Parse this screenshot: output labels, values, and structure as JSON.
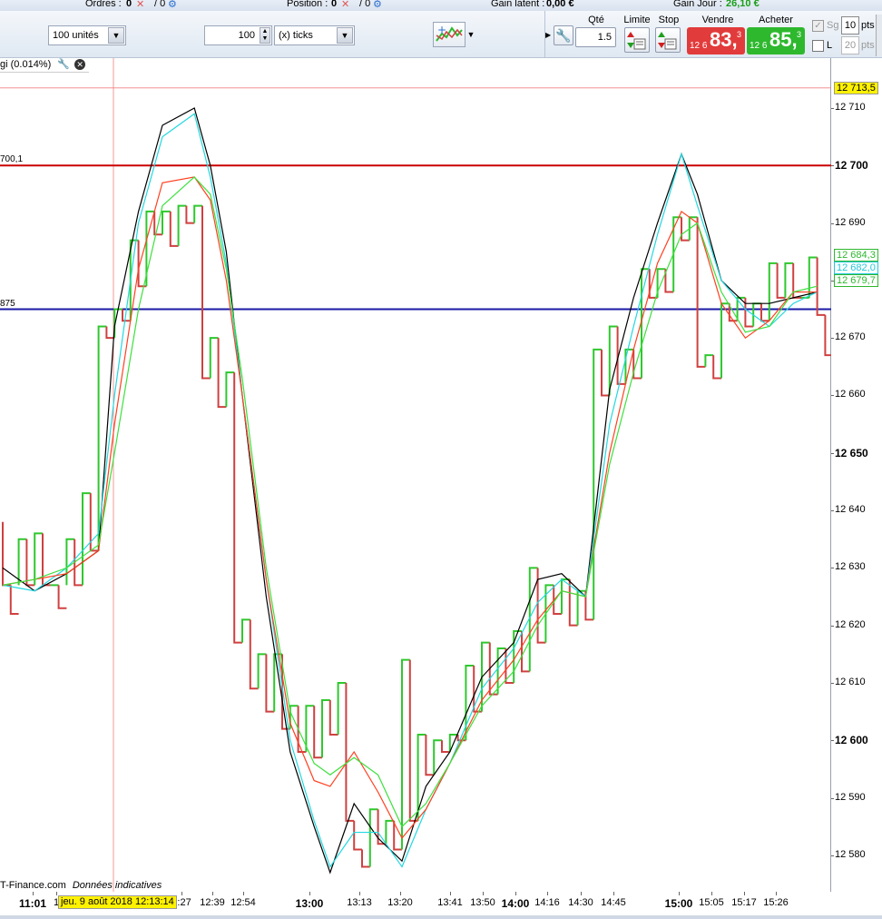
{
  "topbar": {
    "orders_label": "Ordres :",
    "orders_val1": "0",
    "orders_val2": "/ 0",
    "position_label": "Position :",
    "position_val1": "0",
    "position_val2": "/ 0",
    "latent_label": "Gain latent :",
    "latent_value": "0,00 €",
    "day_label": "Gain Jour :",
    "day_value": "26,10 €",
    "day_color": "#1a9e1a"
  },
  "toolbar": {
    "units_value": "100 unités",
    "ticks_value": "100",
    "ticks_unit": "(x) ticks"
  },
  "trade": {
    "qty_label": "Qté",
    "qty_value": "1.5",
    "limit_label": "Limite",
    "stop_label": "Stop",
    "sell_label": "Vendre",
    "buy_label": "Acheter",
    "sell_prefix": "12 6",
    "sell_big": "83,",
    "sell_sup": "3",
    "buy_prefix": "12 6",
    "buy_big": "85,",
    "buy_sup": "3",
    "sg_label": "Sg",
    "l_label": "L",
    "pts1_value": "10",
    "pts2_value": "20",
    "pts_label": "pts",
    "sell_color": "#e23b3b",
    "buy_color": "#2eb82e"
  },
  "chart": {
    "indicator_label": "gi (0.014%)",
    "level1_label": "700,1",
    "level2_label": "875",
    "source_label": "T-Finance.com",
    "source_note": "Données indicatives",
    "date_badge": "jeu. 9 août 2018 12:13:14",
    "level1_value": 12700,
    "level2_value": 12675,
    "cursor_value": 12713.5,
    "red_line_color": "#cc0000",
    "blue_line_color": "#1a1aa6"
  },
  "yaxis": {
    "cursor_badge": "12 713,5",
    "ticks": [
      {
        "label": "12 710",
        "v": 12710,
        "major": false
      },
      {
        "label": "12 700",
        "v": 12700,
        "major": true
      },
      {
        "label": "12 690",
        "v": 12690,
        "major": false
      },
      {
        "label": "12 680",
        "v": 12680,
        "major": false
      },
      {
        "label": "12 670",
        "v": 12670,
        "major": false
      },
      {
        "label": "12 660",
        "v": 12660,
        "major": false
      },
      {
        "label": "12 650",
        "v": 12650,
        "major": true
      },
      {
        "label": "12 640",
        "v": 12640,
        "major": false
      },
      {
        "label": "12 630",
        "v": 12630,
        "major": false
      },
      {
        "label": "12 620",
        "v": 12620,
        "major": false
      },
      {
        "label": "12 610",
        "v": 12610,
        "major": false
      },
      {
        "label": "12 600",
        "v": 12600,
        "major": true
      },
      {
        "label": "12 590",
        "v": 12590,
        "major": false
      },
      {
        "label": "12 580",
        "v": 12580,
        "major": false
      }
    ],
    "badges": [
      {
        "label": "12 684,3",
        "v": 12684.3,
        "color": "#2eb82e"
      },
      {
        "label": "12 682,0",
        "v": 12682.0,
        "color": "#22c8d8"
      },
      {
        "label": "12 679,7",
        "v": 12679.7,
        "color": "#2eb82e"
      }
    ]
  },
  "xaxis": {
    "ticks": [
      {
        "label": "11:01",
        "major": true
      },
      {
        "label": "1",
        "major": false
      },
      {
        "label": "2:27",
        "major": false
      },
      {
        "label": "12:39",
        "major": false
      },
      {
        "label": "12:54",
        "major": false
      },
      {
        "label": "13:00",
        "major": true
      },
      {
        "label": "13:13",
        "major": false
      },
      {
        "label": "13:20",
        "major": false
      },
      {
        "label": "13:41",
        "major": false
      },
      {
        "label": "13:50",
        "major": false
      },
      {
        "label": "14:00",
        "major": true
      },
      {
        "label": "14:16",
        "major": false
      },
      {
        "label": "14:30",
        "major": false
      },
      {
        "label": "14:45",
        "major": false
      },
      {
        "label": "15:00",
        "major": true
      },
      {
        "label": "15:05",
        "major": false
      },
      {
        "label": "15:17",
        "major": false
      },
      {
        "label": "15:26",
        "major": false
      }
    ]
  },
  "chart_data": {
    "type": "candlestick",
    "ylim": [
      12572,
      12716
    ],
    "candles": [
      {
        "o": 12638,
        "c": 12627
      },
      {
        "o": 12627,
        "c": 12622
      },
      {
        "o": 12627,
        "c": 12635
      },
      {
        "o": 12635,
        "c": 12627
      },
      {
        "o": 12627,
        "c": 12636
      },
      {
        "o": 12636,
        "c": 12627
      },
      {
        "o": 12627,
        "c": 12627
      },
      {
        "o": 12627,
        "c": 12623
      },
      {
        "o": 12627,
        "c": 12635
      },
      {
        "o": 12635,
        "c": 12627
      },
      {
        "o": 12627,
        "c": 12643
      },
      {
        "o": 12643,
        "c": 12633
      },
      {
        "o": 12633,
        "c": 12672
      },
      {
        "o": 12672,
        "c": 12670
      },
      {
        "o": 12670,
        "c": 12675
      },
      {
        "o": 12675,
        "c": 12673
      },
      {
        "o": 12673,
        "c": 12687
      },
      {
        "o": 12687,
        "c": 12679
      },
      {
        "o": 12679,
        "c": 12692
      },
      {
        "o": 12692,
        "c": 12688
      },
      {
        "o": 12688,
        "c": 12692
      },
      {
        "o": 12692,
        "c": 12686
      },
      {
        "o": 12686,
        "c": 12693
      },
      {
        "o": 12693,
        "c": 12690
      },
      {
        "o": 12690,
        "c": 12693
      },
      {
        "o": 12693,
        "c": 12663
      },
      {
        "o": 12663,
        "c": 12670
      },
      {
        "o": 12670,
        "c": 12658
      },
      {
        "o": 12658,
        "c": 12664
      },
      {
        "o": 12664,
        "c": 12617
      },
      {
        "o": 12617,
        "c": 12621
      },
      {
        "o": 12621,
        "c": 12609
      },
      {
        "o": 12609,
        "c": 12615
      },
      {
        "o": 12615,
        "c": 12605
      },
      {
        "o": 12605,
        "c": 12615
      },
      {
        "o": 12615,
        "c": 12602
      },
      {
        "o": 12602,
        "c": 12606
      },
      {
        "o": 12606,
        "c": 12598
      },
      {
        "o": 12598,
        "c": 12606
      },
      {
        "o": 12606,
        "c": 12597
      },
      {
        "o": 12597,
        "c": 12607
      },
      {
        "o": 12607,
        "c": 12601
      },
      {
        "o": 12601,
        "c": 12610
      },
      {
        "o": 12610,
        "c": 12586
      },
      {
        "o": 12586,
        "c": 12581
      },
      {
        "o": 12581,
        "c": 12578
      },
      {
        "o": 12578,
        "c": 12588
      },
      {
        "o": 12588,
        "c": 12582
      },
      {
        "o": 12582,
        "c": 12586
      },
      {
        "o": 12586,
        "c": 12581
      },
      {
        "o": 12581,
        "c": 12614
      },
      {
        "o": 12614,
        "c": 12586
      },
      {
        "o": 12586,
        "c": 12601
      },
      {
        "o": 12601,
        "c": 12594
      },
      {
        "o": 12594,
        "c": 12600
      },
      {
        "o": 12600,
        "c": 12598
      },
      {
        "o": 12598,
        "c": 12601
      },
      {
        "o": 12601,
        "c": 12600
      },
      {
        "o": 12600,
        "c": 12613
      },
      {
        "o": 12613,
        "c": 12605
      },
      {
        "o": 12605,
        "c": 12617
      },
      {
        "o": 12617,
        "c": 12608
      },
      {
        "o": 12608,
        "c": 12616
      },
      {
        "o": 12616,
        "c": 12610
      },
      {
        "o": 12610,
        "c": 12619
      },
      {
        "o": 12619,
        "c": 12612
      },
      {
        "o": 12612,
        "c": 12630
      },
      {
        "o": 12630,
        "c": 12617
      },
      {
        "o": 12617,
        "c": 12627
      },
      {
        "o": 12627,
        "c": 12622
      },
      {
        "o": 12622,
        "c": 12628
      },
      {
        "o": 12628,
        "c": 12620
      },
      {
        "o": 12620,
        "c": 12626
      },
      {
        "o": 12626,
        "c": 12621
      },
      {
        "o": 12621,
        "c": 12668
      },
      {
        "o": 12668,
        "c": 12660
      },
      {
        "o": 12660,
        "c": 12672
      },
      {
        "o": 12672,
        "c": 12662
      },
      {
        "o": 12662,
        "c": 12668
      },
      {
        "o": 12668,
        "c": 12663
      },
      {
        "o": 12663,
        "c": 12682
      },
      {
        "o": 12682,
        "c": 12677
      },
      {
        "o": 12677,
        "c": 12682
      },
      {
        "o": 12682,
        "c": 12678
      },
      {
        "o": 12678,
        "c": 12691
      },
      {
        "o": 12691,
        "c": 12687
      },
      {
        "o": 12687,
        "c": 12691
      },
      {
        "o": 12691,
        "c": 12665
      },
      {
        "o": 12665,
        "c": 12667
      },
      {
        "o": 12667,
        "c": 12663
      },
      {
        "o": 12663,
        "c": 12676
      },
      {
        "o": 12676,
        "c": 12673
      },
      {
        "o": 12673,
        "c": 12677
      },
      {
        "o": 12677,
        "c": 12672
      },
      {
        "o": 12672,
        "c": 12676
      },
      {
        "o": 12676,
        "c": 12673
      },
      {
        "o": 12673,
        "c": 12683
      },
      {
        "o": 12683,
        "c": 12677
      },
      {
        "o": 12677,
        "c": 12683
      },
      {
        "o": 12683,
        "c": 12677
      },
      {
        "o": 12677,
        "c": 12677
      },
      {
        "o": 12677,
        "c": 12684
      },
      {
        "o": 12684,
        "c": 12674
      },
      {
        "o": 12674,
        "c": 12667
      }
    ],
    "series": [
      {
        "name": "",
        "color": "#000000",
        "points": [
          [
            0,
            12630
          ],
          [
            4,
            12626
          ],
          [
            8,
            12629
          ],
          [
            12,
            12633
          ],
          [
            14,
            12672
          ],
          [
            17,
            12692
          ],
          [
            20,
            12707
          ],
          [
            24,
            12710
          ],
          [
            26,
            12700
          ],
          [
            28,
            12685
          ],
          [
            30,
            12660
          ],
          [
            33,
            12625
          ],
          [
            36,
            12598
          ],
          [
            39,
            12585
          ],
          [
            41,
            12577
          ],
          [
            44,
            12589
          ],
          [
            47,
            12583
          ],
          [
            50,
            12579
          ],
          [
            53,
            12592
          ],
          [
            56,
            12598
          ],
          [
            60,
            12611
          ],
          [
            64,
            12617
          ],
          [
            67,
            12628
          ],
          [
            70,
            12629
          ],
          [
            73,
            12625
          ],
          [
            76,
            12661
          ],
          [
            79,
            12677
          ],
          [
            82,
            12690
          ],
          [
            85,
            12702
          ],
          [
            87,
            12695
          ],
          [
            90,
            12680
          ],
          [
            93,
            12676
          ],
          [
            96,
            12676
          ],
          [
            99,
            12677
          ],
          [
            102,
            12678
          ]
        ]
      },
      {
        "name": "",
        "color": "#22d8e0",
        "points": [
          [
            0,
            12627
          ],
          [
            4,
            12626
          ],
          [
            8,
            12630
          ],
          [
            12,
            12636
          ],
          [
            14,
            12660
          ],
          [
            17,
            12690
          ],
          [
            20,
            12705
          ],
          [
            24,
            12709
          ],
          [
            26,
            12698
          ],
          [
            28,
            12683
          ],
          [
            30,
            12660
          ],
          [
            33,
            12628
          ],
          [
            36,
            12600
          ],
          [
            39,
            12586
          ],
          [
            41,
            12578
          ],
          [
            44,
            12584
          ],
          [
            47,
            12584
          ],
          [
            50,
            12578
          ],
          [
            53,
            12588
          ],
          [
            56,
            12596
          ],
          [
            60,
            12609
          ],
          [
            64,
            12616
          ],
          [
            67,
            12624
          ],
          [
            70,
            12628
          ],
          [
            73,
            12625
          ],
          [
            76,
            12655
          ],
          [
            79,
            12672
          ],
          [
            82,
            12688
          ],
          [
            85,
            12702
          ],
          [
            87,
            12693
          ],
          [
            90,
            12680
          ],
          [
            93,
            12675
          ],
          [
            96,
            12672
          ],
          [
            99,
            12676
          ],
          [
            102,
            12678
          ]
        ]
      },
      {
        "name": "",
        "color": "#ff4020",
        "points": [
          [
            0,
            12627
          ],
          [
            4,
            12628
          ],
          [
            8,
            12629
          ],
          [
            12,
            12633
          ],
          [
            14,
            12655
          ],
          [
            17,
            12682
          ],
          [
            20,
            12697
          ],
          [
            24,
            12698
          ],
          [
            26,
            12694
          ],
          [
            28,
            12680
          ],
          [
            30,
            12660
          ],
          [
            33,
            12628
          ],
          [
            36,
            12603
          ],
          [
            39,
            12593
          ],
          [
            41,
            12592
          ],
          [
            44,
            12598
          ],
          [
            47,
            12591
          ],
          [
            50,
            12583
          ],
          [
            53,
            12588
          ],
          [
            56,
            12596
          ],
          [
            60,
            12607
          ],
          [
            64,
            12614
          ],
          [
            67,
            12621
          ],
          [
            70,
            12626
          ],
          [
            73,
            12625
          ],
          [
            76,
            12650
          ],
          [
            79,
            12668
          ],
          [
            82,
            12683
          ],
          [
            85,
            12692
          ],
          [
            87,
            12690
          ],
          [
            90,
            12676
          ],
          [
            93,
            12670
          ],
          [
            96,
            12673
          ],
          [
            99,
            12678
          ],
          [
            102,
            12678
          ]
        ]
      },
      {
        "name": "",
        "color": "#3ce03c",
        "points": [
          [
            0,
            12627
          ],
          [
            4,
            12628
          ],
          [
            8,
            12630
          ],
          [
            12,
            12634
          ],
          [
            14,
            12650
          ],
          [
            17,
            12675
          ],
          [
            20,
            12693
          ],
          [
            24,
            12698
          ],
          [
            26,
            12695
          ],
          [
            28,
            12682
          ],
          [
            30,
            12663
          ],
          [
            33,
            12630
          ],
          [
            36,
            12605
          ],
          [
            39,
            12596
          ],
          [
            41,
            12594
          ],
          [
            44,
            12597
          ],
          [
            47,
            12594
          ],
          [
            50,
            12585
          ],
          [
            53,
            12589
          ],
          [
            56,
            12596
          ],
          [
            60,
            12606
          ],
          [
            64,
            12612
          ],
          [
            67,
            12620
          ],
          [
            70,
            12626
          ],
          [
            73,
            12625
          ],
          [
            76,
            12648
          ],
          [
            79,
            12664
          ],
          [
            82,
            12678
          ],
          [
            85,
            12688
          ],
          [
            87,
            12690
          ],
          [
            90,
            12678
          ],
          [
            93,
            12671
          ],
          [
            96,
            12672
          ],
          [
            99,
            12678
          ],
          [
            102,
            12679
          ]
        ]
      }
    ],
    "up_color": "#2ec82e",
    "down_color": "#d04040"
  }
}
